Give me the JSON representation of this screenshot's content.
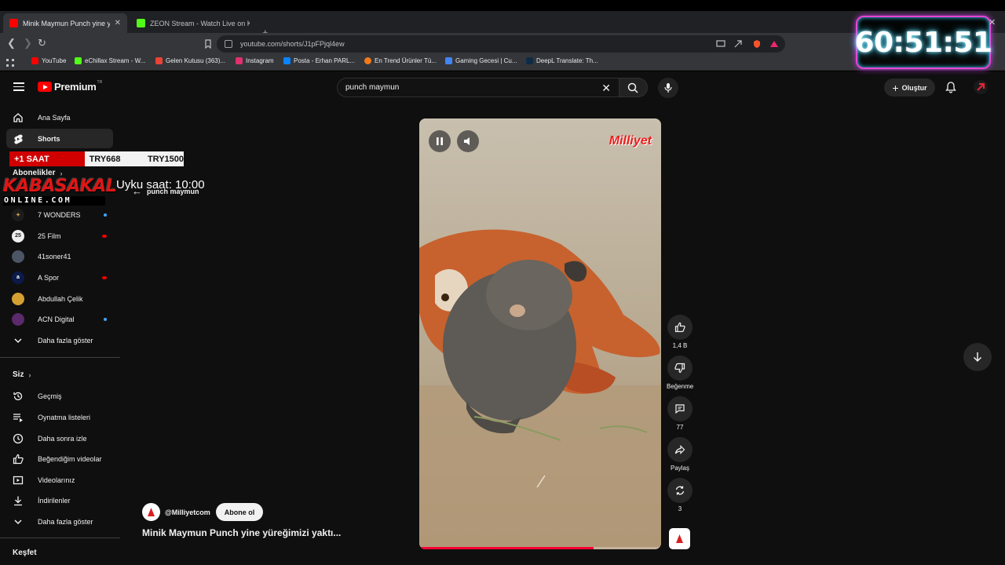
{
  "browser": {
    "tabs": [
      {
        "title": "Minik Maymun Punch yine yü",
        "active": true
      },
      {
        "title": "ZEON Stream - Watch Live on Kick",
        "active": false
      }
    ],
    "url": "youtube.com/shorts/J1pFPjql4ew",
    "bookmarks": [
      {
        "label": "YouTube",
        "color": "#ff0000"
      },
      {
        "label": "eChillax Stream - W...",
        "color": "#53fc18"
      },
      {
        "label": "Gelen Kutusu (363)...",
        "color": "#ea4335"
      },
      {
        "label": "Instagram",
        "color": "#e1306c"
      },
      {
        "label": "Posta - Erhan PARL...",
        "color": "#0a84ff"
      },
      {
        "label": "En Trend Ürünler Tü...",
        "color": "#f27a1a"
      },
      {
        "label": "Gaming Gecesi | Cu...",
        "color": "#4285f4"
      },
      {
        "label": "DeepL Translate: Th...",
        "color": "#0f2b46"
      }
    ]
  },
  "youtube": {
    "brand": "Premium",
    "brand_sup": "TR",
    "search_query": "punch maymun",
    "create_label": "Oluştur",
    "sidebar": {
      "main": [
        {
          "label": "Ana Sayfa",
          "icon": "home-icon"
        },
        {
          "label": "Shorts",
          "icon": "shorts-icon",
          "active": true
        }
      ],
      "subscriptions_heading": "Abonelikler",
      "channels": [
        {
          "label": "7 WONDERS",
          "dot": "#3ea6ff"
        },
        {
          "label": "25 Film",
          "dot": "#ff0000"
        },
        {
          "label": "41soner41",
          "dot": ""
        },
        {
          "label": "A Spor",
          "dot": "#ff0000"
        },
        {
          "label": "Abdullah Çelik",
          "dot": ""
        },
        {
          "label": "ACN Digital",
          "dot": "#3ea6ff"
        }
      ],
      "show_more_1": "Daha fazla göster",
      "you_heading": "Siz",
      "you_items": [
        {
          "label": "Geçmiş",
          "icon": "history-icon"
        },
        {
          "label": "Oynatma listeleri",
          "icon": "playlists-icon"
        },
        {
          "label": "Daha sonra izle",
          "icon": "watch-later-icon"
        },
        {
          "label": "Beğendiğim videolar",
          "icon": "liked-icon"
        },
        {
          "label": "Videolarınız",
          "icon": "your-videos-icon"
        },
        {
          "label": "İndirilenler",
          "icon": "downloads-icon"
        }
      ],
      "show_more_2": "Daha fazla göster",
      "explore_heading": "Keşfet"
    },
    "short": {
      "back_label": "punch maymun",
      "watermark": "Milliyet",
      "channel": "@Milliyetcom",
      "subscribe_label": "Abone ol",
      "title": "Minik Maymun Punch yine yüreğimizi yaktı...",
      "progress": 0.72,
      "actions": {
        "likes": "1,4 B",
        "dislike": "Beğenme",
        "comments": "77",
        "share": "Paylaş",
        "remix": "3"
      }
    }
  },
  "overlay": {
    "bet_label": "+1 SAAT",
    "price1": "TRY668",
    "price2": "TRY1500",
    "brand_main": "KABASAKAL",
    "brand_sub": "ONLINE.COM",
    "sleep_text": "Uyku saat: 10:00",
    "timer": "60:51:51"
  }
}
